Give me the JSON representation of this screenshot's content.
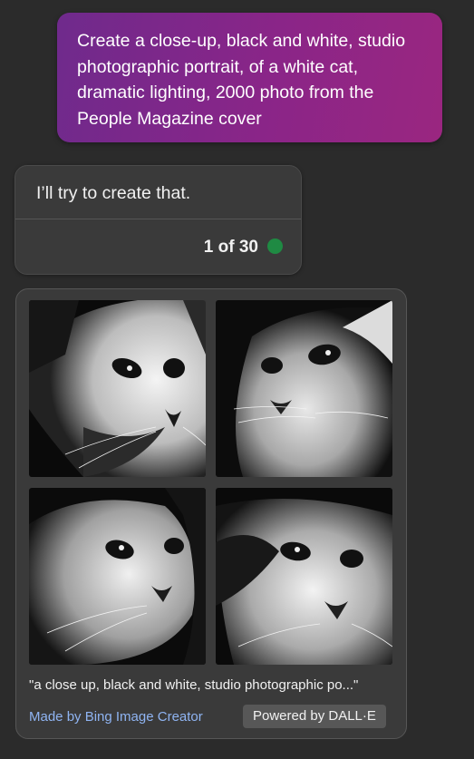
{
  "user_message": {
    "lines": [
      "Create a close-up, black and white, studio",
      "photographic portrait, of a white cat,",
      "dramatic lighting, 2000 photo from the",
      "People Magazine cover"
    ]
  },
  "bot_message": {
    "text": "I’ll try to create that.",
    "counter": "1 of 30",
    "status_color": "#1f8a43"
  },
  "image_card": {
    "images": [
      {
        "name": "cat-image-1"
      },
      {
        "name": "cat-image-2"
      },
      {
        "name": "cat-image-3"
      },
      {
        "name": "cat-image-4"
      }
    ],
    "caption": "\"a close up, black and white, studio photographic po...\"",
    "made_by": "Made by Bing Image Creator",
    "powered_by": "Powered by DALL·E"
  },
  "colors": {
    "user_bubble_start": "#6f2a8c",
    "user_bubble_end": "#9a2680",
    "background": "#2b2b2b",
    "link": "#8fb4f2"
  }
}
